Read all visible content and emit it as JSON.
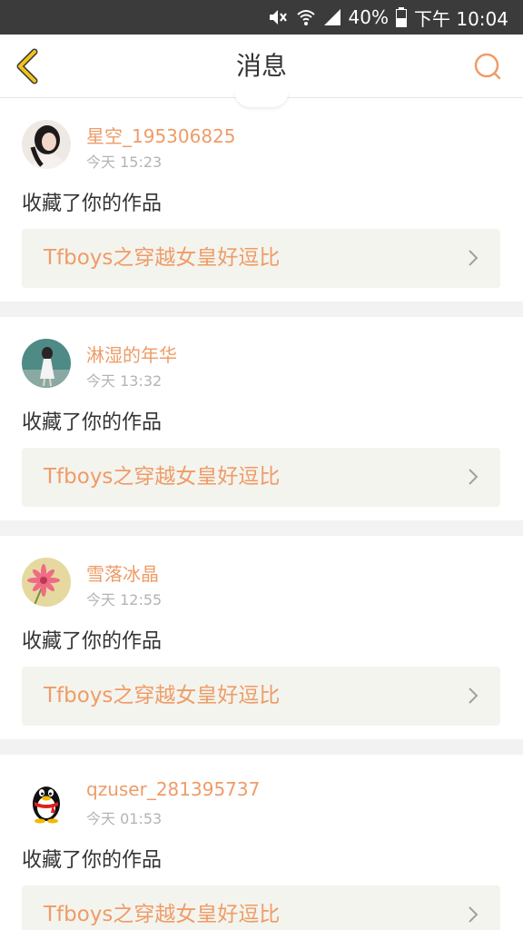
{
  "status_bar": {
    "battery": "40%",
    "time": "下午 10:04"
  },
  "nav": {
    "title": "消息"
  },
  "colors": {
    "accent": "#ee9c68",
    "back_icon": "#f0c419"
  },
  "messages": [
    {
      "username": "星空_195306825",
      "time": "今天 15:23",
      "action": "收藏了你的作品",
      "work_title": "Tfboys之穿越女皇好逗比",
      "avatar": "girl-portrait-avatar"
    },
    {
      "username": "淋湿的年华",
      "time": "今天 13:32",
      "action": "收藏了你的作品",
      "work_title": "Tfboys之穿越女皇好逗比",
      "avatar": "girl-blue-background-avatar"
    },
    {
      "username": "雪落冰晶",
      "time": "今天 12:55",
      "action": "收藏了你的作品",
      "work_title": "Tfboys之穿越女皇好逗比",
      "avatar": "pink-flower-avatar"
    },
    {
      "username": "qzuser_281395737",
      "time": "今天 01:53",
      "action": "收藏了你的作品",
      "work_title": "Tfboys之穿越女皇好逗比",
      "avatar": "qq-penguin-avatar"
    }
  ]
}
